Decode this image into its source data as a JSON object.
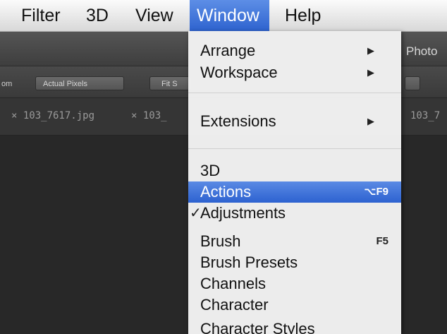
{
  "menubar": {
    "items": [
      {
        "label": "Filter"
      },
      {
        "label": "3D"
      },
      {
        "label": "View"
      },
      {
        "label": "Window"
      },
      {
        "label": "Help"
      }
    ]
  },
  "app": {
    "title": "Photo"
  },
  "options_bar": {
    "zoom_label": "om",
    "actual_pixels": "Actual Pixels",
    "fit_screen": "Fit S"
  },
  "tabs": [
    {
      "label": "× 103_7617.jpg"
    },
    {
      "label": "× 103_"
    },
    {
      "label": "103_7"
    }
  ],
  "window_menu": {
    "items": [
      {
        "label": "Arrange",
        "submenu": "▶"
      },
      {
        "label": "Workspace",
        "submenu": "▶"
      },
      {
        "label": "Extensions",
        "submenu": "▶"
      },
      {
        "label": "3D"
      },
      {
        "label": "Actions",
        "shortcut": "⌥F9",
        "highlighted": true
      },
      {
        "label": "Adjustments",
        "check": "✓"
      },
      {
        "label": "Brush",
        "shortcut": "F5"
      },
      {
        "label": "Brush Presets"
      },
      {
        "label": "Channels"
      },
      {
        "label": "Character"
      },
      {
        "label": "Character Styles"
      }
    ]
  },
  "colors": {
    "menu_highlight": "#2f64d0",
    "menubar_bg": "#ececec",
    "workspace_bg": "#2a2a2a"
  }
}
